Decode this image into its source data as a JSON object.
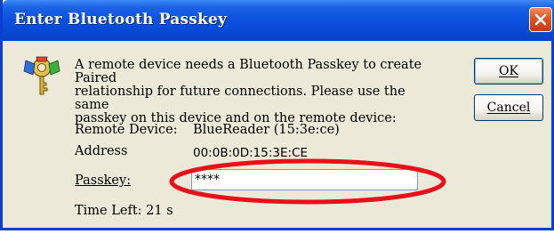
{
  "window": {
    "title": "Enter Bluetooth Passkey"
  },
  "message": {
    "line1": "A remote device needs a Bluetooth Passkey to create Paired",
    "line2": "relationship for future connections. Please use the same",
    "line3": "passkey on this device and on the remote device:"
  },
  "buttons": {
    "ok_label": "OK",
    "cancel_label": "Cancel"
  },
  "fields": {
    "remote_device_label": "Remote Device:",
    "remote_device_value": "BlueReader (15:3e:ce)",
    "address_label": "Address",
    "address_value": "00:0B:0D:15:3E:CE",
    "passkey_label": "Passkey:",
    "passkey_value": "****",
    "time_left": "Time Left: 21 s"
  },
  "icons": {
    "dialog_icon": "bluetooth-key-icon",
    "close_icon": "close-icon"
  },
  "colors": {
    "titlebar": "#0a4fdc",
    "close_button": "#e0521f",
    "highlight": "#e8101a"
  }
}
